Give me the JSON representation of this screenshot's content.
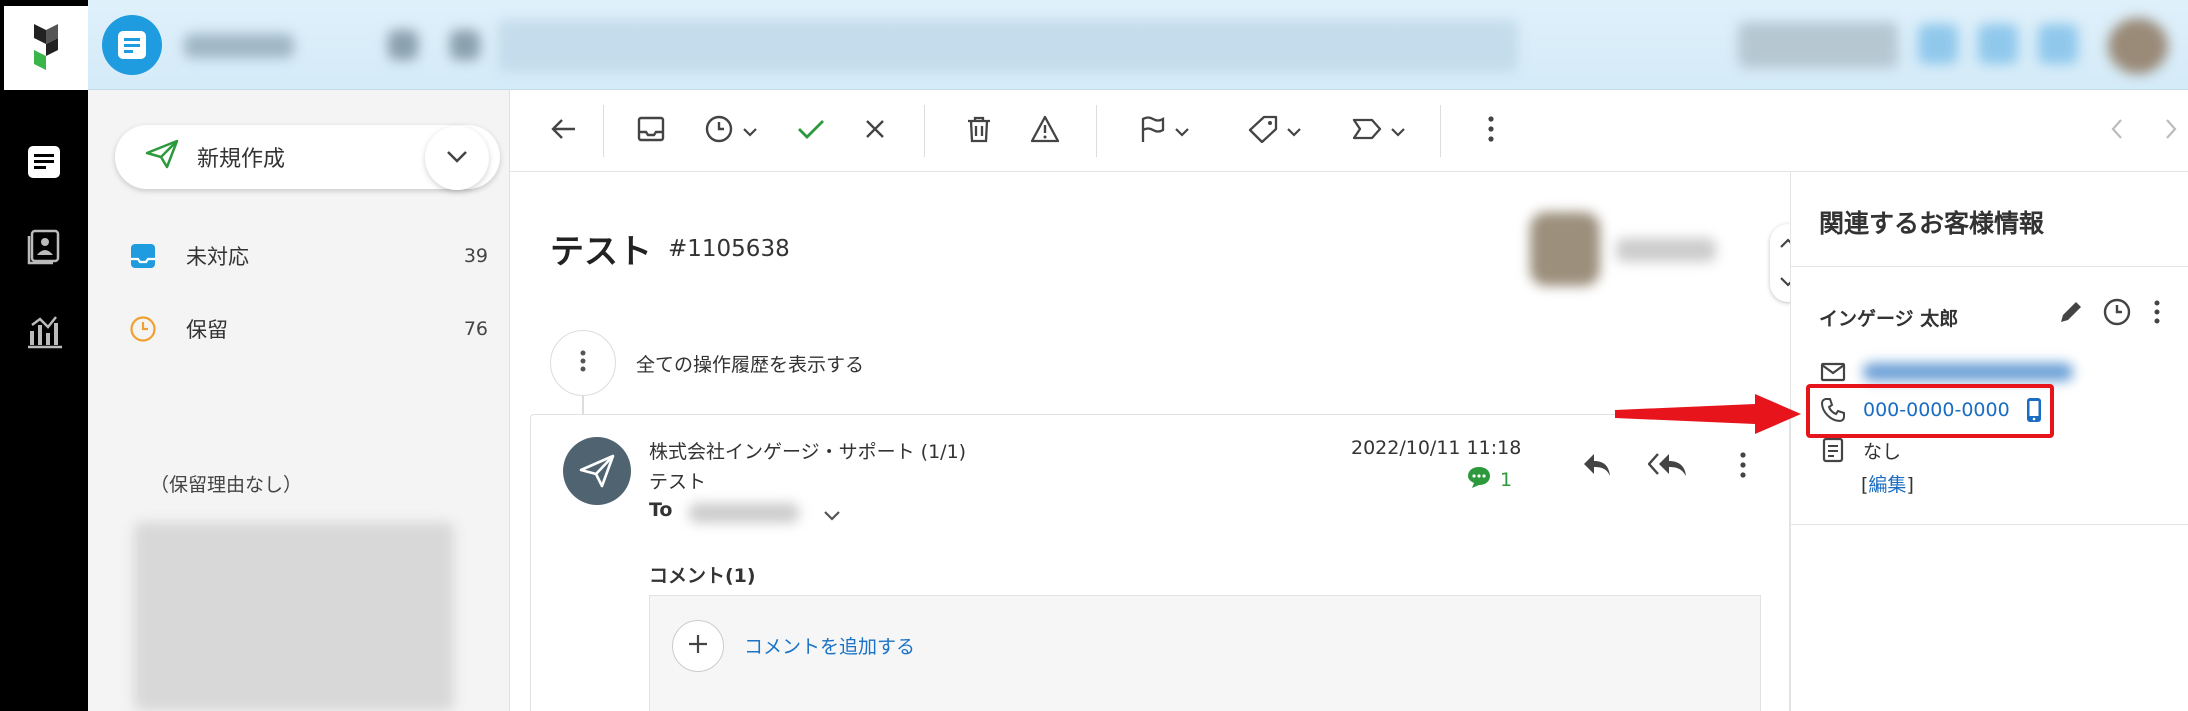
{
  "folders": {
    "new_button_label": "新規作成",
    "items": [
      {
        "label": "未対応",
        "count": "39",
        "icon": "inbox-icon"
      },
      {
        "label": "保留",
        "count": "76",
        "icon": "clock-icon"
      }
    ],
    "hold_reason_none": "（保留理由なし）"
  },
  "message": {
    "subject": "テスト",
    "ticket_id": "#1105638",
    "history_label": "全ての操作履歴を表示する",
    "sender": "株式会社インゲージ・サポート (1/1)",
    "mail_subject": "テスト",
    "to_label": "To",
    "date": "2022/10/11 11:18",
    "comment_count": "1",
    "comments_heading": "コメント(1)",
    "add_comment_label": "コメントを追加する"
  },
  "customer": {
    "panel_title": "関連するお客様情報",
    "name": "インゲージ 太郎",
    "phone": "000-0000-0000",
    "memo": "なし",
    "edit_bracket_open": "[",
    "edit_label": "編集",
    "edit_bracket_close": "]"
  },
  "colors": {
    "accent_blue": "#1f9be0",
    "link_blue": "#1a6dc2",
    "check_green": "#2c9a3c",
    "highlight_red": "#e8141b",
    "hold_orange": "#f0a030"
  }
}
